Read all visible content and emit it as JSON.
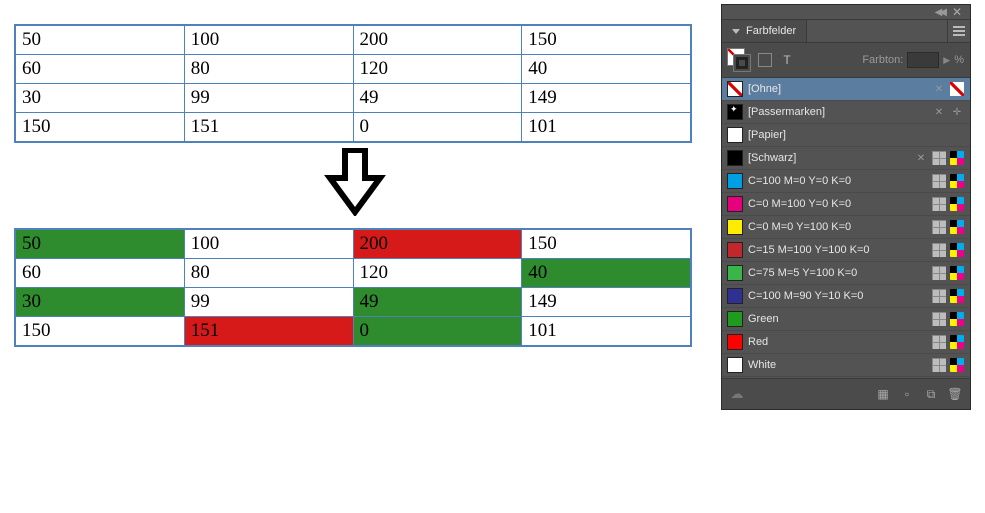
{
  "table1": {
    "rows": [
      [
        "50",
        "100",
        "200",
        "150"
      ],
      [
        "60",
        "80",
        "120",
        "40"
      ],
      [
        "30",
        "99",
        "49",
        "149"
      ],
      [
        "150",
        "151",
        "0",
        "101"
      ]
    ]
  },
  "table2": {
    "rows": [
      [
        {
          "v": "50",
          "c": "green"
        },
        {
          "v": "100"
        },
        {
          "v": "200",
          "c": "red"
        },
        {
          "v": "150"
        }
      ],
      [
        {
          "v": "60"
        },
        {
          "v": "80"
        },
        {
          "v": "120"
        },
        {
          "v": "40",
          "c": "green"
        }
      ],
      [
        {
          "v": "30",
          "c": "green"
        },
        {
          "v": "99"
        },
        {
          "v": "49",
          "c": "green"
        },
        {
          "v": "149"
        }
      ],
      [
        {
          "v": "150"
        },
        {
          "v": "151",
          "c": "red"
        },
        {
          "v": "0",
          "c": "green"
        },
        {
          "v": "101"
        }
      ]
    ]
  },
  "panel": {
    "title": "Farbfelder",
    "tint_label": "Farbton:",
    "tint_unit": "%",
    "swatches": [
      {
        "name": "[Ohne]",
        "style": "none",
        "selected": true,
        "lock": true,
        "uneditable": true
      },
      {
        "name": "[Passermarken]",
        "style": "reg",
        "lock": true,
        "reg": true
      },
      {
        "name": "[Papier]",
        "style": "white"
      },
      {
        "name": "[Schwarz]",
        "style": "black",
        "lock": true,
        "grid": true,
        "cmyk": true
      },
      {
        "name": "C=100 M=0 Y=0 K=0",
        "style": "cmyk-cyan",
        "grid": true,
        "cmyk": true
      },
      {
        "name": "C=0 M=100 Y=0 K=0",
        "style": "cmyk-magenta",
        "grid": true,
        "cmyk": true
      },
      {
        "name": "C=0 M=0 Y=100 K=0",
        "style": "cmyk-yellow",
        "grid": true,
        "cmyk": true
      },
      {
        "name": "C=15 M=100 Y=100 K=0",
        "style": "cmyk-red",
        "grid": true,
        "cmyk": true
      },
      {
        "name": "C=75 M=5 Y=100 K=0",
        "style": "cmyk-green",
        "grid": true,
        "cmyk": true
      },
      {
        "name": "C=100 M=90 Y=10 K=0",
        "style": "cmyk-blue",
        "grid": true,
        "cmyk": true
      },
      {
        "name": "Green",
        "style": "green",
        "grid": true,
        "cmyk": true
      },
      {
        "name": "Red",
        "style": "red",
        "grid": true,
        "cmyk": true
      },
      {
        "name": "White",
        "style": "white",
        "grid": true,
        "cmyk": true
      }
    ]
  }
}
